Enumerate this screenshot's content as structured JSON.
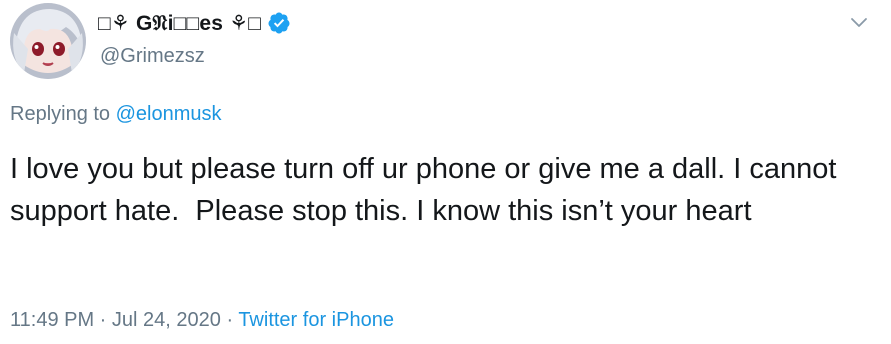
{
  "author": {
    "display_name": "□⚘ G𝔑i□□es ⚘□",
    "handle": "@Grimezsz",
    "verified": true
  },
  "reply": {
    "prefix": "Replying to ",
    "mention": "@elonmusk"
  },
  "tweet": {
    "text": "I love you but please turn off ur phone or give me a dall. I cannot support hate.  Please stop this. I know this isn’t your heart"
  },
  "meta": {
    "time": "11:49 PM",
    "separator_1": " · ",
    "date": "Jul 24, 2020",
    "separator_2": " · ",
    "source": "Twitter for iPhone"
  },
  "colors": {
    "text": "#14171a",
    "secondary": "#657786",
    "link": "#1b95e0",
    "verified": "#1da1f2"
  },
  "icons": {
    "avatar": "avatar",
    "verified": "verified-badge-icon",
    "menu": "chevron-down-icon"
  }
}
